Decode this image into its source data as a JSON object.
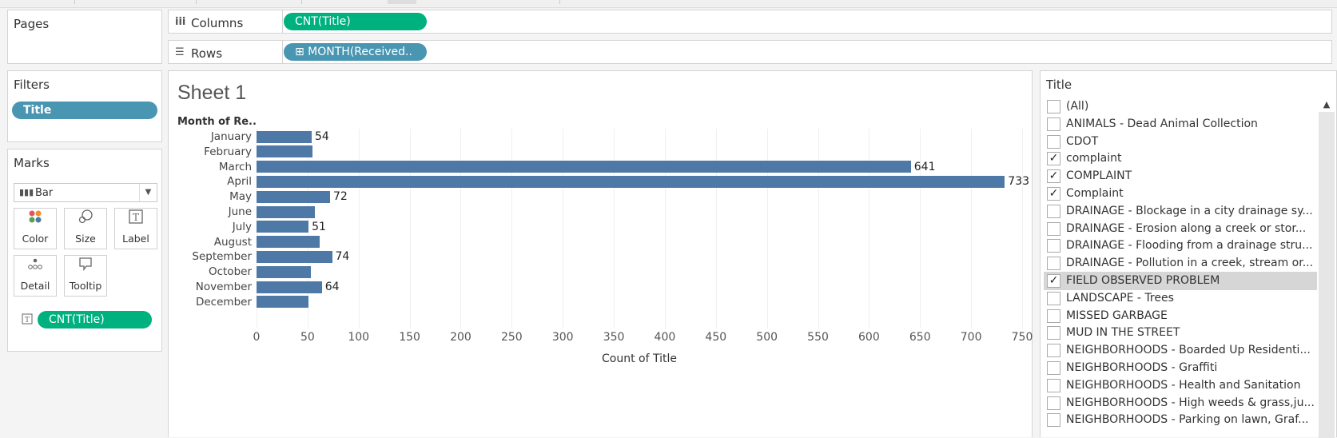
{
  "pages": {
    "title": "Pages"
  },
  "shelves": {
    "columns": {
      "label": "Columns",
      "icon": "iii",
      "pill": "CNT(Title)"
    },
    "rows": {
      "label": "Rows",
      "icon": "☰",
      "pill": "⊞  MONTH(Received.."
    }
  },
  "filters": {
    "title": "Filters",
    "pill": "Title"
  },
  "marks": {
    "title": "Marks",
    "type": "Bar",
    "type_icon": "bar-chart-icon",
    "buttons": [
      {
        "label": "Color",
        "icon": "color-icon"
      },
      {
        "label": "Size",
        "icon": "size-icon"
      },
      {
        "label": "Label",
        "icon": "label-icon"
      },
      {
        "label": "Detail",
        "icon": "detail-icon"
      },
      {
        "label": "Tooltip",
        "icon": "tooltip-icon"
      }
    ],
    "field_pill": "CNT(Title)"
  },
  "sheet": {
    "title": "Sheet 1",
    "row_header": "Month of Re.."
  },
  "chart_data": {
    "type": "bar",
    "orientation": "horizontal",
    "categories": [
      "January",
      "February",
      "March",
      "April",
      "May",
      "June",
      "July",
      "August",
      "September",
      "October",
      "November",
      "December"
    ],
    "values": [
      54,
      55,
      641,
      733,
      72,
      57,
      51,
      62,
      74,
      53,
      64,
      51
    ],
    "labels": [
      "54",
      "",
      "641",
      "733",
      "72",
      "",
      "51",
      "",
      "74",
      "",
      "64",
      ""
    ],
    "xlabel": "Count of Title",
    "ylabel": "Month of Re..",
    "xlim": [
      0,
      750
    ],
    "xticks": [
      0,
      50,
      100,
      150,
      200,
      250,
      300,
      350,
      400,
      450,
      500,
      550,
      600,
      650,
      700,
      750
    ],
    "bar_color": "#4e79a7",
    "grid": true
  },
  "filter_card": {
    "title": "Title",
    "items": [
      {
        "label": "(All)",
        "checked": false
      },
      {
        "label": "ANIMALS - Dead Animal Collection",
        "checked": false
      },
      {
        "label": "CDOT",
        "checked": false
      },
      {
        "label": "complaint",
        "checked": true
      },
      {
        "label": "COMPLAINT",
        "checked": true
      },
      {
        "label": "Complaint",
        "checked": true
      },
      {
        "label": "DRAINAGE - Blockage in a city drainage sy...",
        "checked": false
      },
      {
        "label": "DRAINAGE - Erosion along a creek or stor...",
        "checked": false
      },
      {
        "label": "DRAINAGE - Flooding from a drainage stru...",
        "checked": false
      },
      {
        "label": "DRAINAGE - Pollution in a creek, stream or...",
        "checked": false
      },
      {
        "label": "FIELD OBSERVED PROBLEM",
        "checked": true,
        "selected": true
      },
      {
        "label": "LANDSCAPE - Trees",
        "checked": false
      },
      {
        "label": "MISSED GARBAGE",
        "checked": false
      },
      {
        "label": "MUD IN THE STREET",
        "checked": false
      },
      {
        "label": "NEIGHBORHOODS - Boarded Up Residenti...",
        "checked": false
      },
      {
        "label": "NEIGHBORHOODS - Graffiti",
        "checked": false
      },
      {
        "label": "NEIGHBORHOODS - Health and Sanitation",
        "checked": false
      },
      {
        "label": "NEIGHBORHOODS - High weeds & grass,ju...",
        "checked": false
      },
      {
        "label": "NEIGHBORHOODS - Parking on lawn, Graf...",
        "checked": false
      }
    ]
  },
  "colors": {
    "green_pill": "#00b180",
    "blue_pill": "#4996b2",
    "bar": "#4e79a7"
  }
}
